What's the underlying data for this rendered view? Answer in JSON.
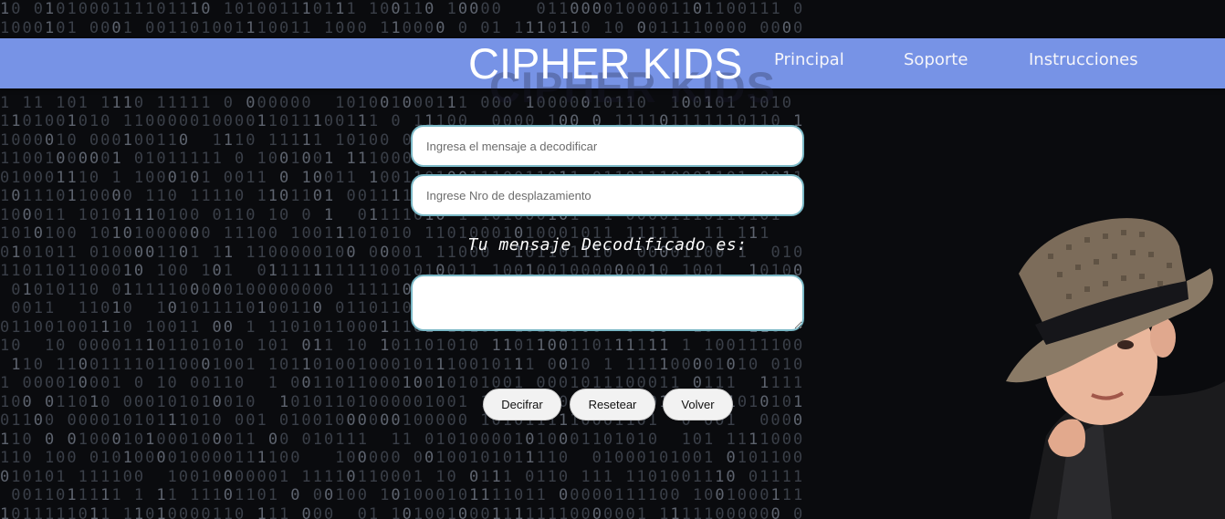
{
  "header": {
    "logo": "CIPHER KIDS",
    "nav": [
      {
        "label": "Principal"
      },
      {
        "label": "Soporte"
      },
      {
        "label": "Instrucciones"
      }
    ]
  },
  "form": {
    "message_placeholder": "Ingresa el mensaje a decodificar",
    "shift_placeholder": "Ingrese Nro de desplazamiento",
    "result_label": "Tu mensaje Decodificado es:",
    "result_value": ""
  },
  "buttons": {
    "decrypt": "Decifrar",
    "reset": "Resetear",
    "back": "Volver"
  },
  "colors": {
    "header": "#7793e6",
    "field_border": "#7ab8c6",
    "background": "#0a0b0e"
  },
  "icons": {
    "illustration": "spy-kid-with-hat-image",
    "background": "binary-matrix-background"
  }
}
